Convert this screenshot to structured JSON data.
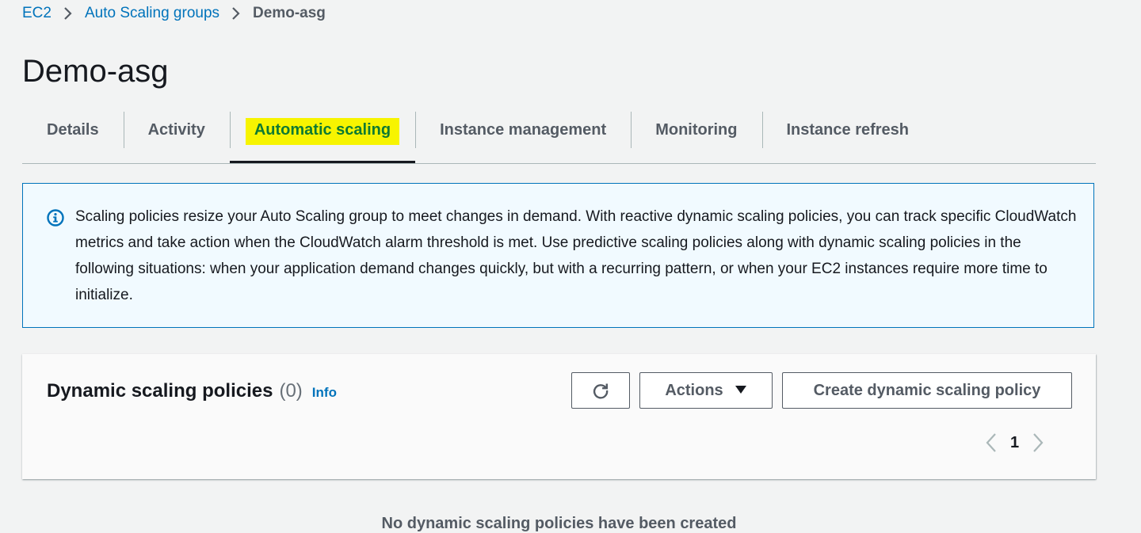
{
  "breadcrumb": {
    "items": [
      "EC2",
      "Auto Scaling groups"
    ],
    "current": "Demo-asg"
  },
  "page": {
    "title": "Demo-asg"
  },
  "tabs": [
    {
      "label": "Details",
      "active": false
    },
    {
      "label": "Activity",
      "active": false
    },
    {
      "label": "Automatic scaling",
      "active": true,
      "highlight_color": "#f7f400"
    },
    {
      "label": "Instance management",
      "active": false
    },
    {
      "label": "Monitoring",
      "active": false
    },
    {
      "label": "Instance refresh",
      "active": false
    }
  ],
  "info_alert": {
    "icon": "info-icon",
    "text": "Scaling policies resize your Auto Scaling group to meet changes in demand. With reactive dynamic scaling policies, you can track specific CloudWatch metrics and take action when the CloudWatch alarm threshold is met. Use predictive scaling policies along with dynamic scaling policies in the following situations: when your application demand changes quickly, but with a recurring pattern, or when your EC2 instances require more time to initialize."
  },
  "dynamic_policies": {
    "title": "Dynamic scaling policies",
    "count": "(0)",
    "info_label": "Info",
    "refresh_icon": "refresh-icon",
    "actions_label": "Actions",
    "create_label": "Create dynamic scaling policy",
    "pagination": {
      "current_page": "1"
    },
    "empty_message": "No dynamic scaling policies have been created"
  },
  "colors": {
    "link": "#0073bb",
    "alert_border": "#0073bb",
    "alert_bg": "#f1faff",
    "tab_highlight": "#f7f400",
    "active_tab_text": "#0e7a32"
  }
}
